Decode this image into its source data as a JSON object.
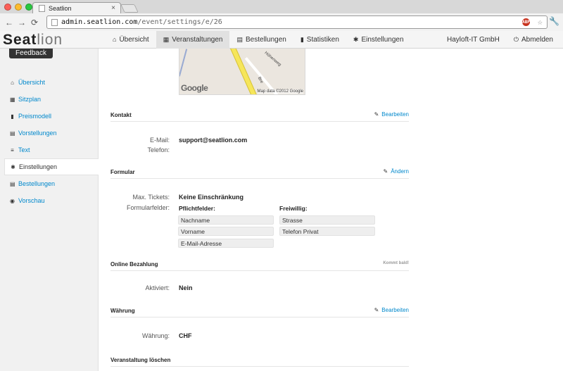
{
  "browser": {
    "tab_title": "Seatlion",
    "tab_close": "×",
    "url_host": "admin.seatlion.com",
    "url_path": "/event/settings/e/26",
    "abp_label": "ABP",
    "back_glyph": "←",
    "forward_glyph": "→",
    "reload_glyph": "⟳"
  },
  "brand": {
    "part1": "Seat",
    "part2": "lion"
  },
  "navbar": {
    "items": [
      {
        "label": "Übersicht",
        "icon": "home-icon",
        "glyph": "⌂"
      },
      {
        "label": "Veranstaltungen",
        "icon": "grid-icon",
        "glyph": "▦"
      },
      {
        "label": "Bestellungen",
        "icon": "table-icon",
        "glyph": "▤"
      },
      {
        "label": "Statistiken",
        "icon": "chart-icon",
        "glyph": "▮"
      },
      {
        "label": "Einstellungen",
        "icon": "gear-icon",
        "glyph": "✱"
      }
    ],
    "company": "Hayloft-IT GmbH",
    "logout_label": "Abmelden",
    "logout_glyph": "⏻"
  },
  "sidebar": {
    "feedback_label": "Feedback",
    "items": [
      {
        "label": "Übersicht",
        "glyph": "⌂"
      },
      {
        "label": "Sitzplan",
        "glyph": "▦"
      },
      {
        "label": "Preismodell",
        "glyph": "▮"
      },
      {
        "label": "Vorstellungen",
        "glyph": "▤"
      },
      {
        "label": "Text",
        "glyph": "≡"
      },
      {
        "label": "Einstellungen",
        "glyph": "✱"
      },
      {
        "label": "Bestellungen",
        "glyph": "▤"
      },
      {
        "label": "Vorschau",
        "glyph": "◉"
      }
    ],
    "active_index": 5
  },
  "map": {
    "street1": "Höhenweg",
    "street2": "Bre",
    "logo": "Google",
    "data_text": "Map data ©2012 Google"
  },
  "sections": {
    "kontakt": {
      "title": "Kontakt",
      "action": "Bearbeiten"
    },
    "formular": {
      "title": "Formular",
      "action": "Ändern"
    },
    "online": {
      "title": "Online Bezahlung",
      "note": "Kommt bald!"
    },
    "waehrung": {
      "title": "Währung",
      "action": "Bearbeiten"
    },
    "loeschen": {
      "title": "Veranstaltung löschen"
    }
  },
  "kontakt": {
    "email_label": "E-Mail:",
    "email_value": "support@seatlion.com",
    "phone_label": "Telefon:",
    "phone_value": ""
  },
  "formular": {
    "max_label": "Max. Tickets:",
    "max_value": "Keine Einschränkung",
    "fields_label": "Formularfelder:",
    "required_header": "Pflichtfelder:",
    "required": [
      "Nachname",
      "Vorname",
      "E-Mail-Adresse"
    ],
    "optional_header": "Freiwillig:",
    "optional": [
      "Strasse",
      "Telefon Privat"
    ]
  },
  "online": {
    "label": "Aktiviert:",
    "value": "Nein"
  },
  "waehrung": {
    "label": "Währung:",
    "value": "CHF"
  },
  "colors": {
    "link": "#0088cc",
    "feedback_bg": "#333333",
    "road": "#f6e65a"
  }
}
